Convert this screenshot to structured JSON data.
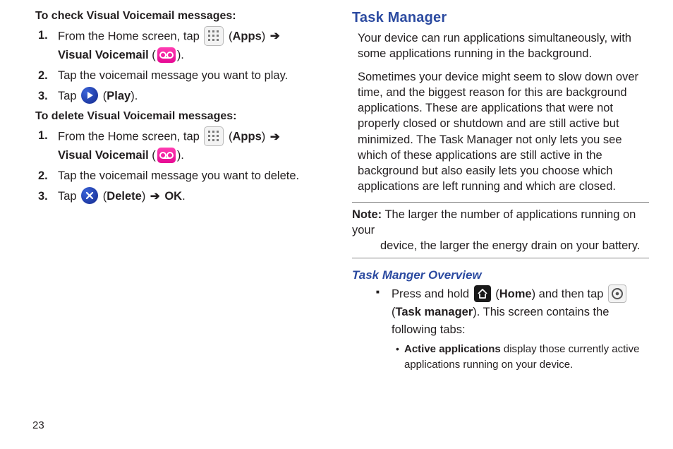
{
  "page_number": "23",
  "left": {
    "check_heading": "To check Visual Voicemail messages:",
    "check_steps": {
      "s1a": "From the Home screen, tap ",
      "apps_label": "Apps",
      "vvm_label": "Visual Voicemail",
      "s2": "Tap the voicemail message you want to play.",
      "s3a": "Tap ",
      "play_label": "Play"
    },
    "delete_heading": "To delete Visual Voicemail messages:",
    "delete_steps": {
      "s1a": "From the Home screen, tap ",
      "apps_label": "Apps",
      "vvm_label": "Visual Voicemail",
      "s2": "Tap the voicemail message you want to delete.",
      "s3a": "Tap ",
      "delete_label": "Delete",
      "ok_label": "OK"
    }
  },
  "right": {
    "heading": "Task Manager",
    "p1": "Your device can run applications simultaneously, with some applications running in the background.",
    "p2": "Sometimes your device might seem to slow down over time, and the biggest reason for this are background applications. These are applications that were not properly closed or shutdown and are still active but minimized. The Task Manager not only lets you see which of these applications are still active in the background but also easily lets you choose which applications are left running and which are closed.",
    "note_label": "Note:",
    "note_line1": " The larger the number of applications running on your",
    "note_line2": "device, the larger the energy drain on your battery.",
    "sub_heading": "Task Manger Overview",
    "ov_a": "Press and hold ",
    "home_label": "Home",
    "ov_b": " and then tap ",
    "tm_label": "Task manager",
    "ov_c": ". This screen contains the following tabs:",
    "bullet_b": "Active applications",
    "bullet_rest": " display those currently active applications running on your device."
  }
}
